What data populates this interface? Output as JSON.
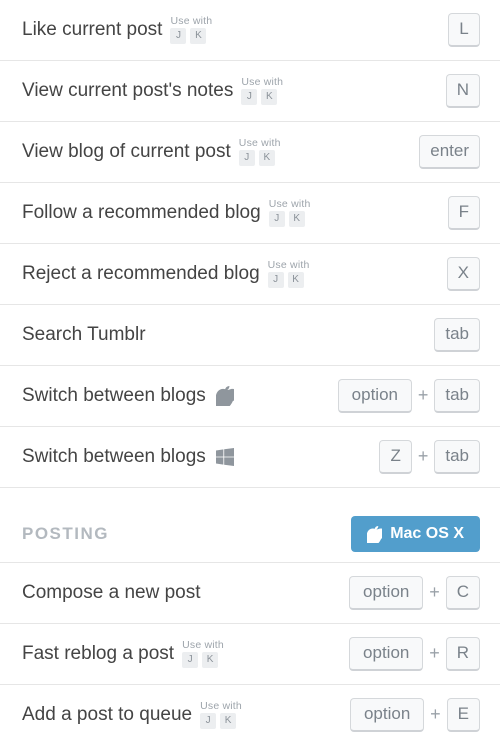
{
  "usewith_label": "Use with",
  "usewith_keys": [
    "J",
    "K"
  ],
  "plus": "+",
  "rows": [
    {
      "label": "Like current post",
      "usewith": true,
      "keys": [
        "L"
      ]
    },
    {
      "label": "View current post's notes",
      "usewith": true,
      "keys": [
        "N"
      ]
    },
    {
      "label": "View blog of current post",
      "usewith": true,
      "keys": [
        "enter"
      ]
    },
    {
      "label": "Follow a recommended blog",
      "usewith": true,
      "keys": [
        "F"
      ]
    },
    {
      "label": "Reject a recommended blog",
      "usewith": true,
      "keys": [
        "X"
      ]
    },
    {
      "label": "Search Tumblr",
      "usewith": false,
      "keys": [
        "tab"
      ]
    },
    {
      "label": "Switch between blogs",
      "platform": "apple",
      "keys": [
        "option",
        "tab"
      ]
    },
    {
      "label": "Switch between blogs",
      "platform": "windows",
      "keys": [
        "Z",
        "tab"
      ]
    }
  ],
  "section": {
    "title": "POSTING",
    "os_label": "Mac OS X"
  },
  "posting_rows": [
    {
      "label": "Compose a new post",
      "usewith": false,
      "keys": [
        "option",
        "C"
      ]
    },
    {
      "label": "Fast reblog a post",
      "usewith": true,
      "keys": [
        "option",
        "R"
      ]
    },
    {
      "label": "Add a post to queue",
      "usewith": true,
      "keys": [
        "option",
        "E"
      ]
    }
  ]
}
